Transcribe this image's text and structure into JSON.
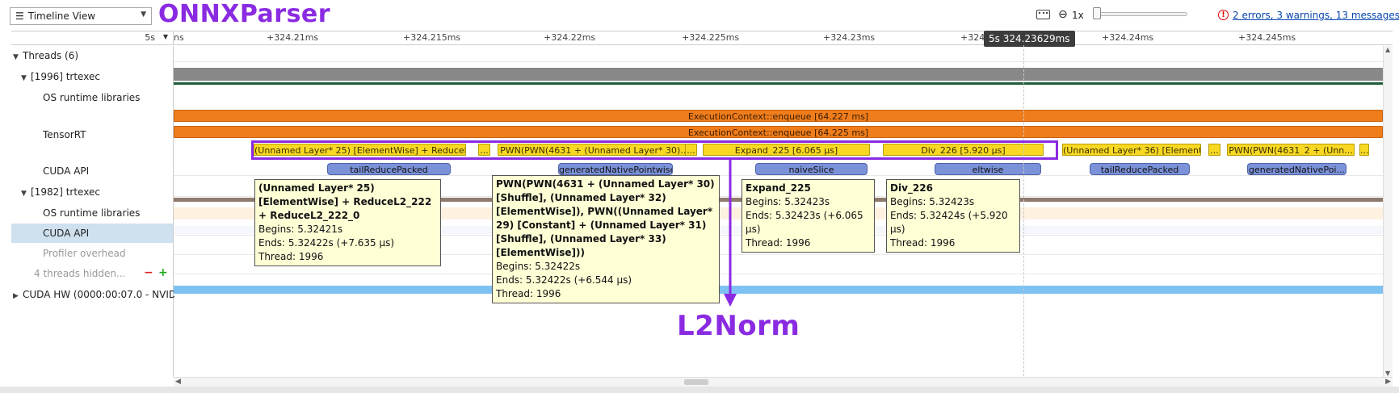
{
  "toolbar": {
    "view_select": "Timeline View",
    "zoom_level": "1x",
    "messages_link": "2 errors, 3 warnings, 13 messages",
    "error_glyph": "!"
  },
  "annotations": {
    "onnx_parser": "ONNXParser",
    "l2norm": "L2Norm",
    "color": "#8a2be2"
  },
  "ruler": {
    "unit": "5s",
    "ticks": [
      "ns",
      "+324.21ms",
      "+324.215ms",
      "+324.22ms",
      "+324.225ms",
      "+324.23ms",
      "+324.2",
      "+324.24ms",
      "+324.245ms"
    ],
    "cursor_time": "5s 324.23629ms"
  },
  "tree": {
    "threads": "Threads (6)",
    "thread1": "[1996] trtexec",
    "os_runtime1": "OS runtime libraries",
    "tensorrt": "TensorRT",
    "cuda_api1": "CUDA API",
    "thread2": "[1982] trtexec",
    "os_runtime2": "OS runtime libraries",
    "cuda_api2": "CUDA API",
    "profiler": "Profiler overhead",
    "hidden": "4 threads hidden...",
    "cuda_hw": "CUDA HW (0000:00:07.0 - NVIDIA"
  },
  "tensorrt_bars": {
    "enqueue1": "ExecutionContext::enqueue [64.227 ms]",
    "enqueue2": "ExecutionContext::enqueue [64.225 ms]",
    "layer25": "(Unnamed Layer* 25) [ElementWise] + ReduceL...",
    "ellipsis1": "...",
    "pwn4631": "PWN(PWN(4631 + (Unnamed Layer* 30)...",
    "ellipsis2": "...",
    "expand": "Expand_225 [6.065 µs]",
    "div": "Div_226 [5.920 µs]",
    "layer36": "(Unnamed Layer* 36) [Element...",
    "ellipsis3": "...",
    "pwn4631_2": "PWN(PWN(4631_2 + (Unn...",
    "ellipsis4": "..."
  },
  "cuda_bars": {
    "k1": "tailReducePacked",
    "k2": "generatedNativePointwise",
    "k3": "naiveSlice",
    "k4": "eltwise",
    "k5": "tailReducePacked",
    "k6": "generatedNativePoi..."
  },
  "tooltips": {
    "t1": {
      "title": "(Unnamed Layer* 25) [ElementWise] + ReduceL2_222 + ReduceL2_222_0",
      "begins": "Begins: 5.32421s",
      "ends": "Ends: 5.32422s (+7.635 µs)",
      "thread": "Thread: 1996"
    },
    "t2": {
      "title": "PWN(PWN(4631 + (Unnamed Layer* 30) [Shuffle], (Unnamed Layer* 32) [ElementWise]), PWN((Unnamed Layer* 29) [Constant] + (Unnamed Layer* 31) [Shuffle], (Unnamed Layer* 33) [ElementWise]))",
      "begins": "Begins: 5.32422s",
      "ends": "Ends: 5.32422s (+6.544 µs)",
      "thread": "Thread: 1996"
    },
    "t3": {
      "title": "Expand_225",
      "begins": "Begins: 5.32423s",
      "ends": "Ends: 5.32423s (+6.065 µs)",
      "thread": "Thread: 1996"
    },
    "t4": {
      "title": "Div_226",
      "begins": "Begins: 5.32423s",
      "ends": "Ends: 5.32424s (+5.920 µs)",
      "thread": "Thread: 1996"
    }
  }
}
